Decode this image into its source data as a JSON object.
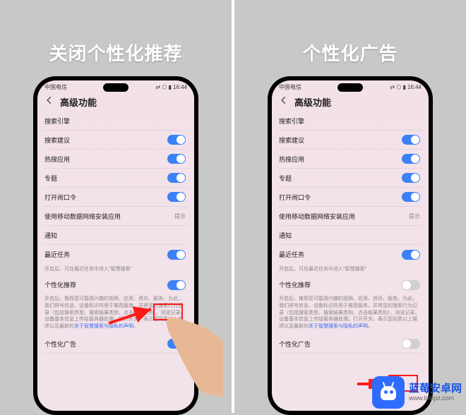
{
  "watermark": {
    "line1": "蓝莓安卓网",
    "line2": "www.lmkjst.com"
  },
  "panels": {
    "left": {
      "title": "关闭个性化推荐",
      "statusbar": {
        "carrier": "中国电信",
        "time": "16:44",
        "icons": "⇄ ⬡ ▮"
      },
      "header": "高级功能",
      "rows": {
        "search_engine": "搜索引擎",
        "search_suggest": "搜索建议",
        "hot_search": "热搜应用",
        "topics": "专题",
        "open_pwd": "打开闹口令",
        "mobile_data": "使用移动数据网络安装应用",
        "mobile_data_hint": "提示",
        "notifications": "通知",
        "recent_tasks": "最近任务",
        "recent_tasks_note": "开启后，可在最近任务中进入\"智慧搜索\"",
        "personalized_rec": "个性化推荐",
        "rec_desc": "开启后，推荐您可能感兴趣的视频、应用、资讯、服务。为此，我们将号信息、设备标识符用于推荐服务，并将您的搜索行为记录（包括搜索类型、搜索结果类别、点击结果类别）、浏览记录、设备基本信息上传给服务器处理。打开开关，表示您同意以上描述以及最新的",
        "rec_link": "关于智慧搜索与隐私的声明",
        "rec_period": "。",
        "personalized_ads": "个性化广告"
      }
    },
    "right": {
      "title": "个性化广告",
      "statusbar": {
        "carrier": "中国电信",
        "time": "16:44",
        "icons": "⇄ ⬡ ▮"
      },
      "header": "高级功能",
      "rows": {
        "search_engine": "搜索引擎",
        "search_suggest": "搜索建议",
        "hot_search": "热搜应用",
        "topics": "专题",
        "open_pwd": "打开闹口令",
        "mobile_data": "使用移动数据网络安装应用",
        "mobile_data_hint": "提示",
        "notifications": "通知",
        "recent_tasks": "最近任务",
        "recent_tasks_note": "开启后，可在最近任务中进入\"智慧搜索\"",
        "personalized_rec": "个性化推荐",
        "rec_desc": "开启后，推荐您可能感兴趣的视频、应用、资讯、服务。为此，我们将号信息、设备标识符用于推荐服务，并将您的搜索行为记录（包括搜索类型、搜索结果类别、点击结果类别）、浏览记录、设备基本信息上传给服务器处理。打开开关，表示您同意以上描述以及最新的",
        "rec_link": "关于智慧搜索与隐私的声明",
        "rec_period": "。",
        "personalized_ads": "个性化广告"
      }
    }
  }
}
